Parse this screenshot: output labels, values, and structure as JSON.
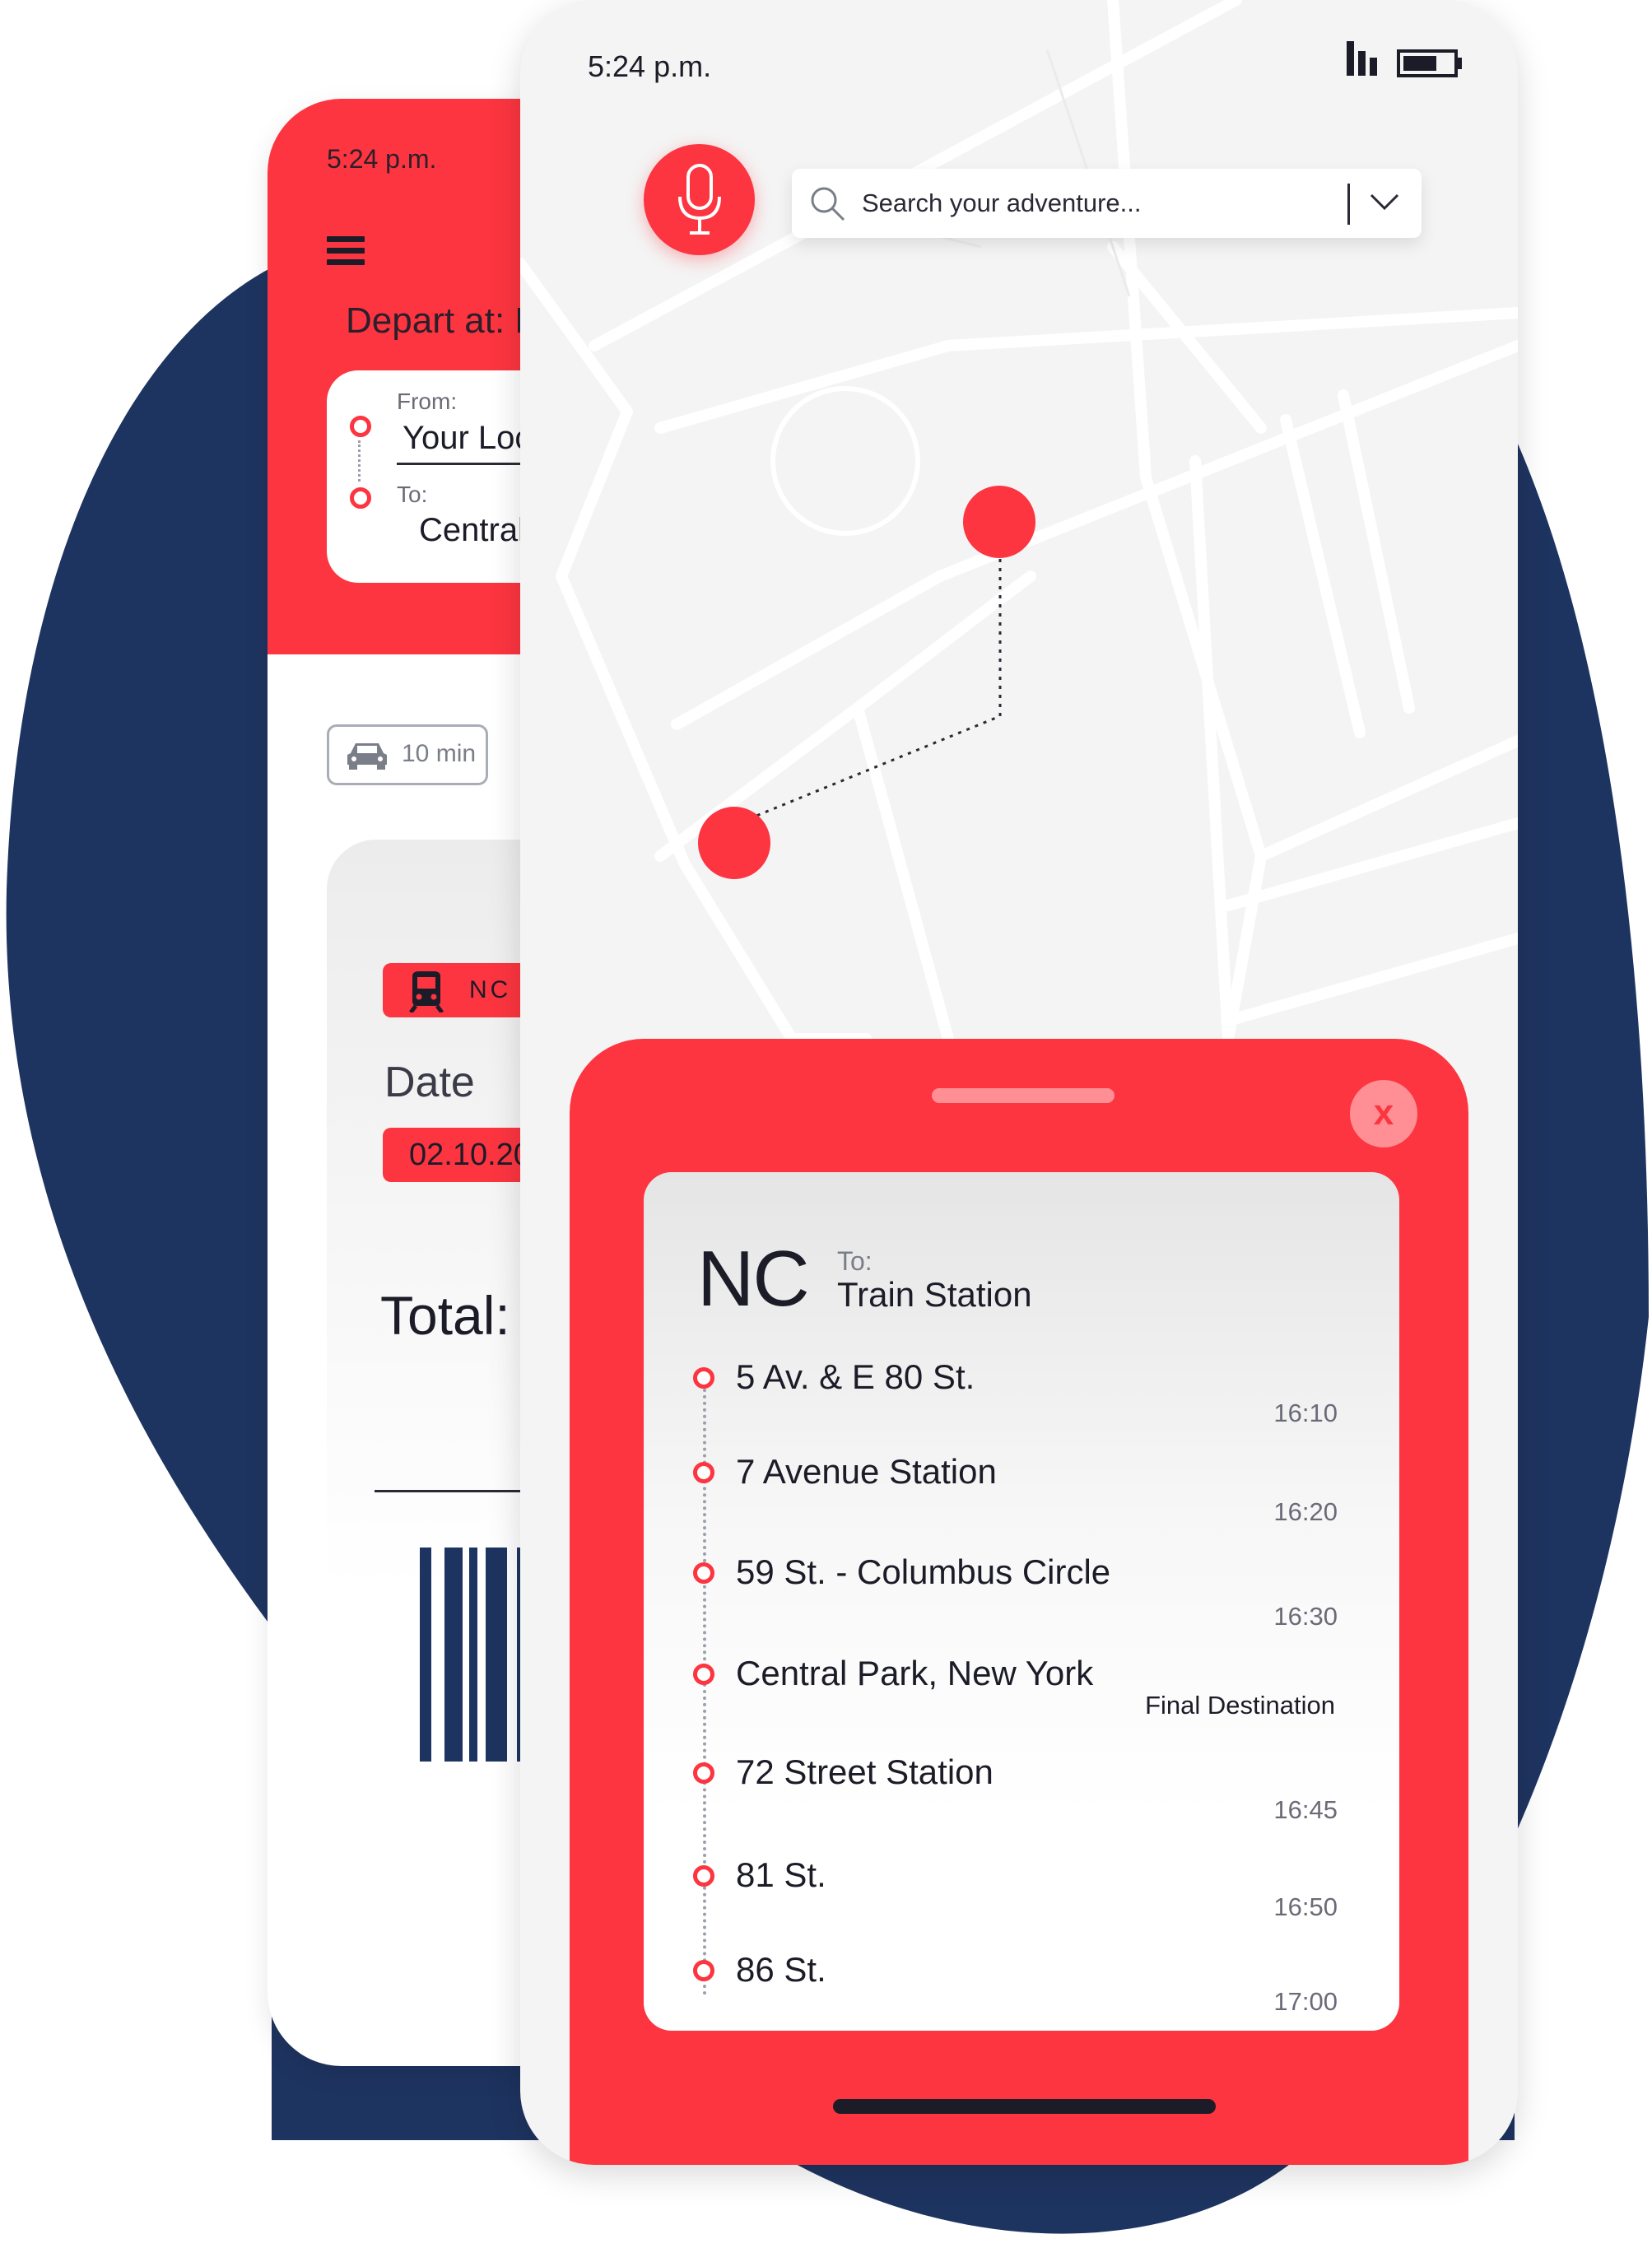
{
  "colors": {
    "accent": "#fc3540",
    "accent_light": "#ff8f94",
    "navy": "#1e3460",
    "text_dark": "#1c1c28",
    "map_bg": "#f4f4f4"
  },
  "back_screen": {
    "status_time": "5:24 p.m.",
    "depart_label": "Depart at: N",
    "from_label": "From:",
    "from_value": "Your Loc",
    "to_label": "To:",
    "to_value": "Central",
    "duration": "10 min",
    "ticket": {
      "route_badge": "NC",
      "date_label": "Date",
      "date_value": "02.10.20",
      "total_label": "Total:"
    }
  },
  "front_screen": {
    "status_time": "5:24 p.m.",
    "search_placeholder": "Search your adventure...",
    "sheet": {
      "close_label": "x",
      "route_id": "NC",
      "to_label": "To:",
      "to_value": "Train Station",
      "stops": [
        {
          "name": "5 Av. & E 80 St.",
          "time": "16:10"
        },
        {
          "name": "7 Avenue Station",
          "time": "16:20"
        },
        {
          "name": "59 St. - Columbus Circle",
          "time": "16:30"
        },
        {
          "name": "Central Park, New York",
          "time": "Final Destination"
        },
        {
          "name": "72 Street Station",
          "time": "16:45"
        },
        {
          "name": "81 St.",
          "time": "16:50"
        },
        {
          "name": "86 St.",
          "time": "17:00"
        }
      ]
    }
  },
  "icons": {
    "menu": "hamburger-icon",
    "car": "car-icon",
    "train": "train-icon",
    "mic": "microphone-icon",
    "search": "search-icon",
    "chevron": "chevron-down-icon",
    "signal": "signal-icon",
    "battery": "battery-icon",
    "close": "close-icon",
    "barcode": "barcode-icon"
  }
}
